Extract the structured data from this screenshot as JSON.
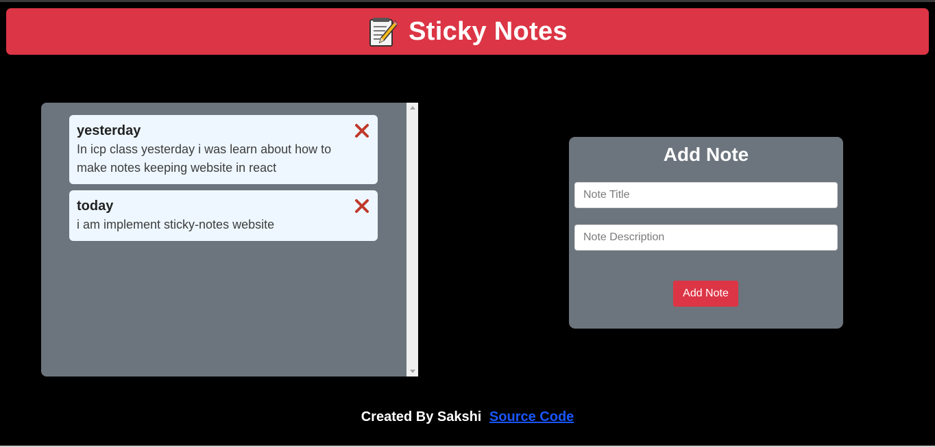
{
  "colors": {
    "accent": "#dc3545",
    "panel": "#6c757d",
    "note_bg": "#eef7ff",
    "link": "#1a56ff",
    "delete": "#c0392b"
  },
  "header": {
    "icon": "memo-icon",
    "title": "Sticky Notes"
  },
  "notes": [
    {
      "title": "yesterday",
      "description": "In icp class yesterday i was learn about how to make notes keeping website in react",
      "delete_icon": "cross-icon"
    },
    {
      "title": "today",
      "description": "i am implement sticky-notes website",
      "delete_icon": "cross-icon"
    }
  ],
  "add_form": {
    "title": "Add Note",
    "title_placeholder": "Note Title",
    "description_placeholder": "Note Description",
    "button_label": "Add Note"
  },
  "footer": {
    "text": "Created By Sakshi",
    "link_label": "Source Code"
  }
}
